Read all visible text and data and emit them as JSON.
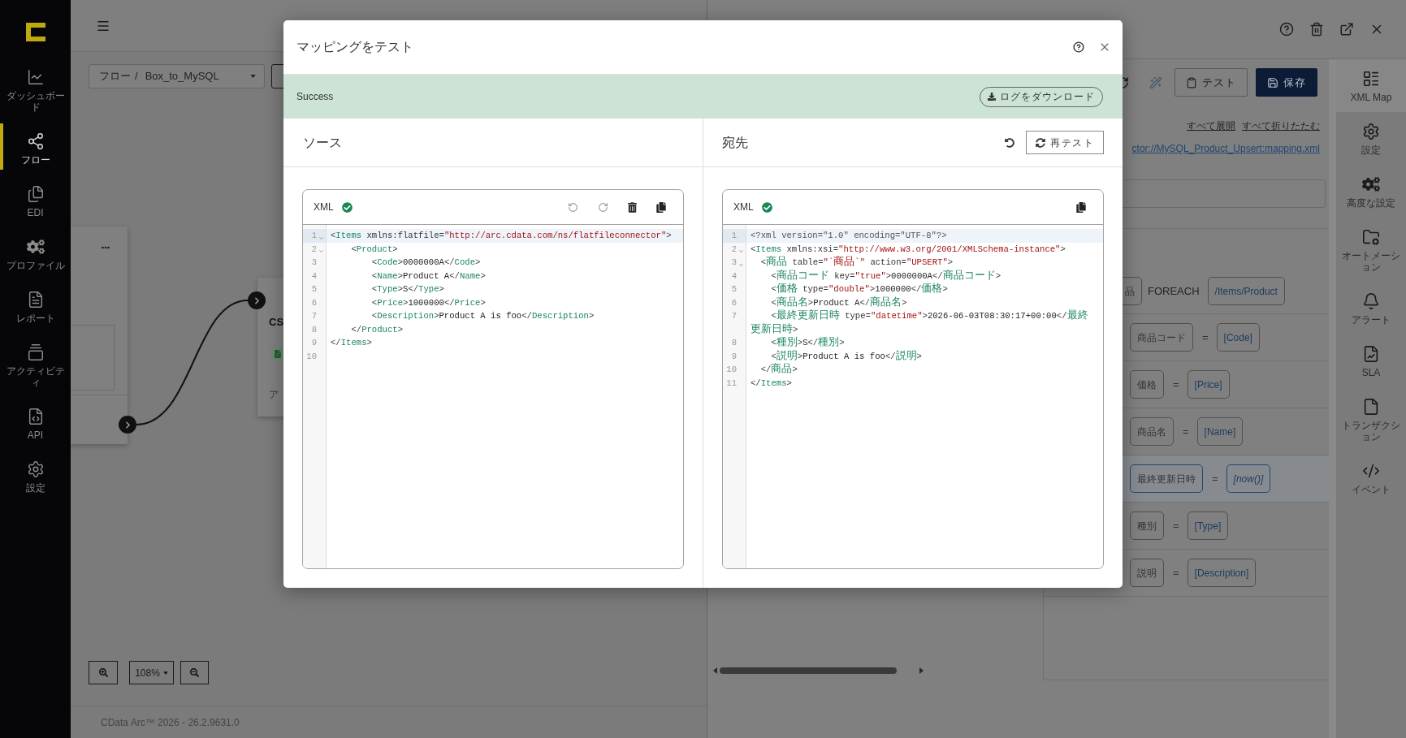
{
  "sidebar": {
    "items": [
      {
        "label": "ダッシュボード",
        "selected": false
      },
      {
        "label": "フロー",
        "selected": true
      },
      {
        "label": "EDI",
        "selected": false
      },
      {
        "label": "プロファイル",
        "selected": false
      },
      {
        "label": "レポート",
        "selected": false
      },
      {
        "label": "アクティビティ",
        "selected": false
      },
      {
        "label": "API",
        "selected": false
      },
      {
        "label": "設定",
        "selected": false
      }
    ]
  },
  "breadcrumb": {
    "path": "フロー",
    "separator": "/",
    "name": "Box_to_MySQL"
  },
  "canvas": {
    "partial_node": {
      "title": "CS",
      "caption": "ア"
    }
  },
  "zoom": {
    "value": "108%"
  },
  "footer": {
    "version": "CData Arc™ 2026 - 26.2.9631.0"
  },
  "mapping_panel": {
    "toolbar_buttons": [
      {
        "label": "テスト",
        "kind": "secondary"
      },
      {
        "label": "保存",
        "kind": "primary"
      }
    ],
    "links": [
      "すべて展開",
      "すべて折りたたむ"
    ],
    "file_link": "ctor://MySQL_Product_Upsert:mapping.xml",
    "loop": {
      "target": "品",
      "keyword": "FOREACH",
      "source": "/Items/Product"
    },
    "rows": [
      {
        "target": "商品コード",
        "operator": "=",
        "source": "[Code]",
        "kind": "field",
        "selected": false
      },
      {
        "target": "価格",
        "operator": "=",
        "source": "[Price]",
        "kind": "field",
        "selected": false
      },
      {
        "target": "商品名",
        "operator": "=",
        "source": "[Name]",
        "kind": "field",
        "selected": false
      },
      {
        "target": "最終更新日時",
        "operator": "=",
        "source": "[now()]",
        "kind": "expression",
        "selected": true
      },
      {
        "target": "種別",
        "operator": "=",
        "source": "[Type]",
        "kind": "field",
        "selected": false
      },
      {
        "target": "説明",
        "operator": "=",
        "source": "[Description]",
        "kind": "field",
        "selected": false
      }
    ]
  },
  "rail": {
    "items": [
      {
        "label": "XML Map",
        "selected": true
      },
      {
        "label": "設定",
        "selected": false
      },
      {
        "label": "高度な設定",
        "selected": false
      },
      {
        "label": "オートメーション",
        "selected": false
      },
      {
        "label": "アラート",
        "selected": false
      },
      {
        "label": "SLA",
        "selected": false
      },
      {
        "label": "トランザクション",
        "selected": false
      },
      {
        "label": "イベント",
        "selected": false
      }
    ]
  },
  "dialog": {
    "title": "マッピングをテスト",
    "status": {
      "kind": "success",
      "text": "Success"
    },
    "download_button": "ログをダウンロード",
    "source": {
      "heading": "ソース",
      "editor": {
        "language": "XML",
        "valid": true,
        "editable": true,
        "lines": [
          {
            "number": "1",
            "text": "<Items xmlns:flatfile=\"http://arc.cdata.com/ns/flatfileconnector\">",
            "active": true,
            "foldable": true
          },
          {
            "number": "2",
            "text": "    <Product>",
            "active": false,
            "foldable": true
          },
          {
            "number": "3",
            "text": "        <Code>0000000A</Code>",
            "active": false,
            "foldable": false
          },
          {
            "number": "4",
            "text": "        <Name>Product A</Name>",
            "active": false,
            "foldable": false
          },
          {
            "number": "5",
            "text": "        <Type>S</Type>",
            "active": false,
            "foldable": false
          },
          {
            "number": "6",
            "text": "        <Price>1000000</Price>",
            "active": false,
            "foldable": false
          },
          {
            "number": "7",
            "text": "        <Description>Product A is foo</Description>",
            "active": false,
            "foldable": false
          },
          {
            "number": "8",
            "text": "    </Product>",
            "active": false,
            "foldable": false
          },
          {
            "number": "9",
            "text": "</Items>",
            "active": false,
            "foldable": false
          },
          {
            "number": "10",
            "active": false,
            "foldable": false
          }
        ]
      }
    },
    "destination": {
      "heading": "宛先",
      "retest_button": "再テスト",
      "editor": {
        "language": "XML",
        "valid": true,
        "editable": false,
        "lines": [
          {
            "number": "1",
            "text": "<?xml version=\"1.0\" encoding=\"UTF-8\"?>",
            "active": true,
            "foldable": false
          },
          {
            "number": "2",
            "text": "<Items xmlns:xsi=\"http://www.w3.org/2001/XMLSchema-instance\">",
            "active": false,
            "foldable": true
          },
          {
            "number": "3",
            "text": "  <商品 table=\"`商品`\" action=\"UPSERT\">",
            "active": false,
            "foldable": true
          },
          {
            "number": "4",
            "text": "    <商品コード key=\"true\">0000000A</商品コード>",
            "active": false,
            "foldable": false
          },
          {
            "number": "5",
            "text": "    <価格 type=\"double\">1000000</価格>",
            "active": false,
            "foldable": false
          },
          {
            "number": "6",
            "text": "    <商品名>Product A</商品名>",
            "active": false,
            "foldable": false
          },
          {
            "number": "7",
            "text": "    <最終更新日時 type=\"datetime\">2026-06-03T08:30:17+00:00</最終",
            "active": false,
            "foldable": false
          },
          {
            "text": "更新日時>",
            "active": false,
            "foldable": false
          },
          {
            "number": "8",
            "text": "    <種別>S</種別>",
            "active": false,
            "foldable": false
          },
          {
            "number": "9",
            "text": "    <説明>Product A is foo</説明>",
            "active": false,
            "foldable": false
          },
          {
            "number": "10",
            "text": "  </商品>",
            "active": false,
            "foldable": false
          },
          {
            "number": "11",
            "text": "</Items>",
            "active": false,
            "foldable": false
          }
        ]
      }
    }
  }
}
